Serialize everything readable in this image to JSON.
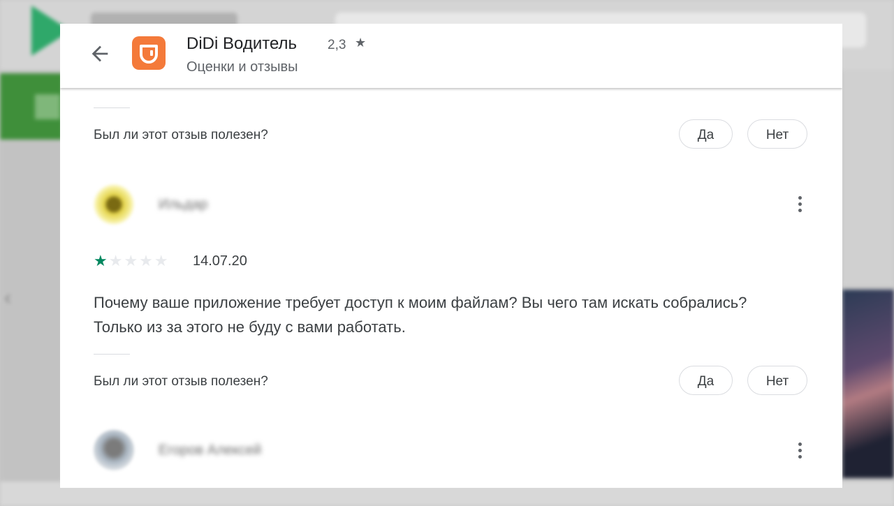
{
  "colors": {
    "accent_green": "#01875f",
    "app_icon_orange": "#f47a3a",
    "text_primary": "#202124",
    "text_secondary": "#5f6368"
  },
  "header": {
    "back_icon": "arrow-left-icon",
    "app_icon": "didi-logo-icon",
    "app_name": "DiDi Водитель",
    "rating": "2,3",
    "rating_star": "★",
    "subtitle": "Оценки и отзывы"
  },
  "reviews": [
    {
      "helpful_question": "Был ли этот отзыв полезен?",
      "yes_label": "Да",
      "no_label": "Нет"
    },
    {
      "author": "Ильдар",
      "rating": 1,
      "max_rating": 5,
      "date": "14.07.20",
      "text": "Почему ваше приложение требует доступ к моим файлам? Вы чего там искать собрались? Только из за этого не буду с вами работать.",
      "helpful_question": "Был ли этот отзыв полезен?",
      "yes_label": "Да",
      "no_label": "Нет",
      "menu_icon": "more-vert-icon"
    },
    {
      "author": "Егоров Алексей",
      "menu_icon": "more-vert-icon"
    }
  ]
}
